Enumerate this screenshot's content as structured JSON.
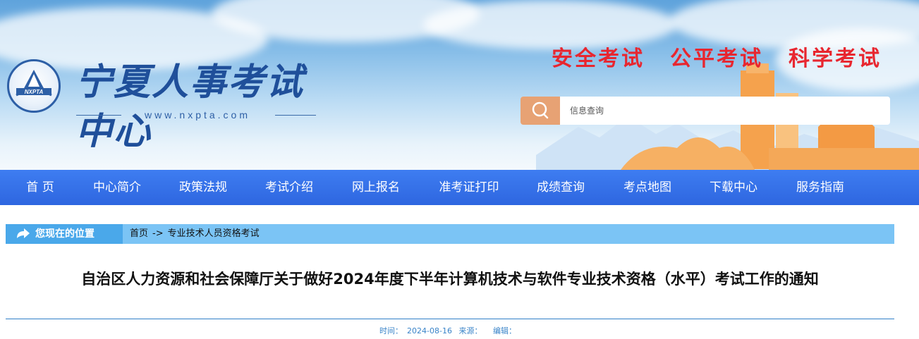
{
  "header": {
    "logo_badge_text": "NXPTA",
    "logo_title": "宁夏人事考试中心",
    "logo_url": "www.nxpta.com",
    "slogans": [
      "安全考试",
      "公平考试",
      "科学考试"
    ],
    "search": {
      "placeholder": "信息查询",
      "value": ""
    },
    "colors": {
      "slogan": "#e8262f",
      "search_button": "#e7a274"
    }
  },
  "nav": {
    "items": [
      "首  页",
      "中心简介",
      "政策法规",
      "考试介绍",
      "网上报名",
      "准考证打印",
      "成绩查询",
      "考点地图",
      "下载中心",
      "服务指南"
    ],
    "color": "#3573e8"
  },
  "breadcrumb": {
    "tag": "您现在的位置",
    "home": "首页",
    "separator": "->",
    "current": "专业技术人员资格考试"
  },
  "article": {
    "title": "自治区人力资源和社会保障厅关于做好2024年度下半年计算机技术与软件专业技术资格（水平）考试工作的通知",
    "time_label": "时间：",
    "time_value": "2024-08-16",
    "source_label": "来源：",
    "source_value": "",
    "editor_label": "编辑：",
    "editor_value": ""
  }
}
